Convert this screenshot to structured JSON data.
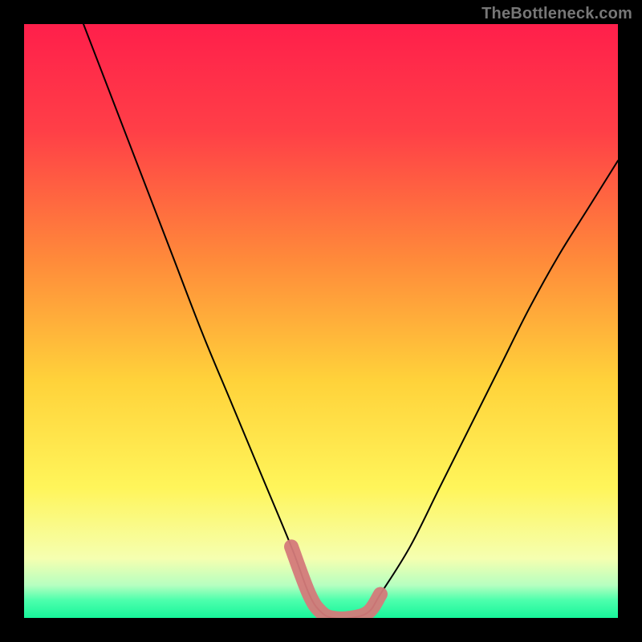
{
  "watermark": {
    "text": "TheBottleneck.com"
  },
  "chart_data": {
    "type": "line",
    "title": "",
    "xlabel": "",
    "ylabel": "",
    "xlim": [
      0,
      100
    ],
    "ylim": [
      0,
      100
    ],
    "series": [
      {
        "name": "bottleneck-curve",
        "x": [
          10,
          15,
          20,
          25,
          30,
          35,
          40,
          45,
          48,
          50,
          52,
          55,
          58,
          60,
          65,
          70,
          75,
          80,
          85,
          90,
          95,
          100
        ],
        "y": [
          100,
          87,
          74,
          61,
          48,
          36,
          24,
          12,
          4,
          1,
          0,
          0,
          1,
          4,
          12,
          22,
          32,
          42,
          52,
          61,
          69,
          77
        ]
      }
    ],
    "highlight": {
      "name": "bottleneck-range",
      "x": [
        45,
        48,
        50,
        52,
        55,
        58,
        60
      ],
      "y": [
        12,
        4,
        1,
        0,
        0,
        1,
        4
      ]
    },
    "gradient_stops": [
      {
        "offset": 0.0,
        "color": "#ff1f4b"
      },
      {
        "offset": 0.18,
        "color": "#ff3f47"
      },
      {
        "offset": 0.4,
        "color": "#ff8b3a"
      },
      {
        "offset": 0.6,
        "color": "#ffd23a"
      },
      {
        "offset": 0.78,
        "color": "#fff55a"
      },
      {
        "offset": 0.9,
        "color": "#f5ffb0"
      },
      {
        "offset": 0.945,
        "color": "#b6ffc0"
      },
      {
        "offset": 0.97,
        "color": "#4dffad"
      },
      {
        "offset": 1.0,
        "color": "#17f59a"
      }
    ]
  }
}
